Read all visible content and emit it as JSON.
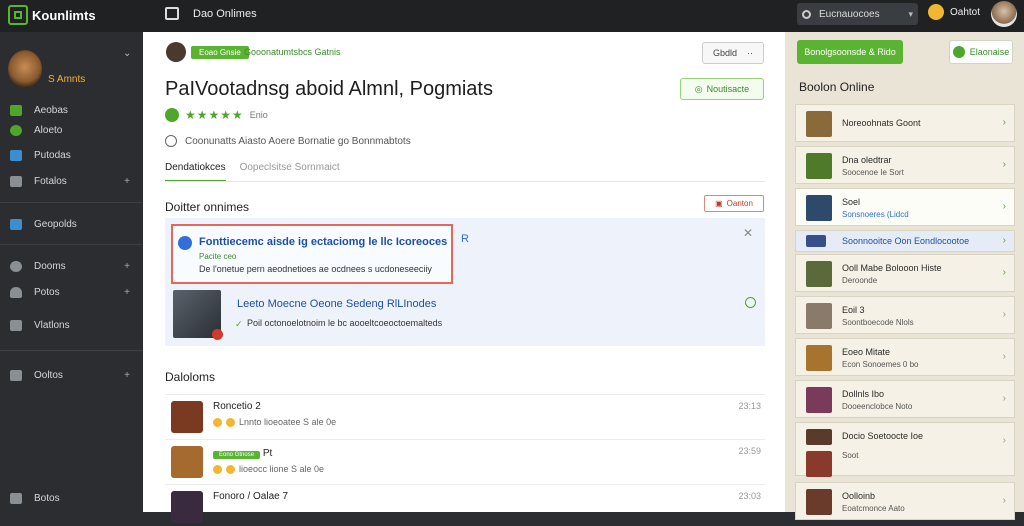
{
  "topbar": {
    "logo_text": "Kounlimts",
    "title": "Dao Onlimes",
    "search_text": "Eucnauocoes",
    "user_name": "Oahtot"
  },
  "sidebar": {
    "user_name": "S Amnts",
    "items": [
      {
        "label": "Aeobas",
        "icon": "home-icon",
        "plus": false
      },
      {
        "label": "Aloeto",
        "icon": "globe-icon",
        "plus": false
      },
      {
        "label": "Putodas",
        "icon": "chart-icon",
        "plus": false
      },
      {
        "label": "Fotalos",
        "icon": "grid-icon",
        "plus": true
      },
      {
        "label": "Geopolds",
        "icon": "check-icon",
        "plus": false
      },
      {
        "label": "Dooms",
        "icon": "globe-icon",
        "plus": true
      },
      {
        "label": "Potos",
        "icon": "user-icon",
        "plus": true
      },
      {
        "label": "Vlatlons",
        "icon": "list-icon",
        "plus": false
      },
      {
        "label": "Ooltos",
        "icon": "download-icon",
        "plus": true
      },
      {
        "label": "Botos",
        "icon": "grid-icon",
        "plus": false
      }
    ]
  },
  "main": {
    "project_pill": "Eoao Gnsie",
    "project_link": "Gooonatumtsbcs Gatnis",
    "top_button": "Gbdld",
    "title": "PaIVootadnsg aboid Almnl, Pogmiats",
    "follow_button": "Noutisacte",
    "rating_stars": "★★★★★",
    "rating_label": "Enio",
    "meta_line": "Coonunatts Aiasto Aoere Bornatie go Bonnmabtots",
    "tabs": [
      "Dendatiokces",
      "Oopeclsitse Sornmaict"
    ],
    "section_title": "Doitter onnimes",
    "red_button": "Oanton",
    "highlight": {
      "title": "Fonttiecemc aisde ig ectaciomg le llc Icoreoces",
      "sub": "Pacite ceo",
      "desc": "De l'onetue pern aeodnetioes ae ocdnees s ucdoneseeciiy",
      "tag": "R"
    },
    "second_item": {
      "title": "Leeto Moecne Oeone Sedeng RlLInodes",
      "desc": "Poil octonoelotnoim le bc aooeltcoeoctoemalteds"
    },
    "section2_title": "Daloloms",
    "rows": [
      {
        "title": "Roncetio 2",
        "sub": "Lnnto lioeoatee S ale 0e",
        "time": "23:13",
        "pill": "",
        "color": "#7a3a22"
      },
      {
        "title": "Pt",
        "sub": "lioeocc lione S ale 0e",
        "time": "23:59",
        "pill": "Eono Gtnose",
        "color": "#a46a2e"
      },
      {
        "title": "Fonoro / Oalae 7",
        "sub": "",
        "time": "23:03",
        "pill": "",
        "color": "#3a2a40"
      }
    ]
  },
  "right_panel": {
    "green_button": "Bonolgsoonsde & Rido",
    "secondary_button": "Elaonaise",
    "title": "Boolon Online",
    "cards": [
      {
        "title": "Noreoohnats Goont",
        "sub": "",
        "color": "#8a6a3a"
      },
      {
        "title": "Dna oledtrar",
        "sub": "Soocenoe Ie Sort",
        "color": "#4f7a2a"
      },
      {
        "title": "Soel",
        "sub": "Sonsnoeres (Lidcd",
        "color": "#2e4a6a"
      },
      {
        "title": "Soonnooitce Oon Eondlocootoe",
        "sub": "",
        "color": "#3a4f8a"
      },
      {
        "title": "Ooll Mabe Bolooon Histe",
        "sub": "Deroonde",
        "color": "#5a6a3a"
      },
      {
        "title": "Eoil 3",
        "sub": "Soontboecode Nlols",
        "color": "#8a7a6a"
      },
      {
        "title": "Eoeo Mitate",
        "sub": "Econ Sonoemes 0 bo",
        "color": "#a6742e"
      },
      {
        "title": "Dollnls Ibo",
        "sub": "Dooeenclobce Noto",
        "color": "#7a3a5a"
      },
      {
        "title": "Docio Soetoocte Ioe",
        "sub": "Soot",
        "color": "#5a3a2a"
      },
      {
        "title": "Oolloinb",
        "sub": "Eoatcmonce Aato",
        "color": "#6a3a2a"
      }
    ]
  }
}
